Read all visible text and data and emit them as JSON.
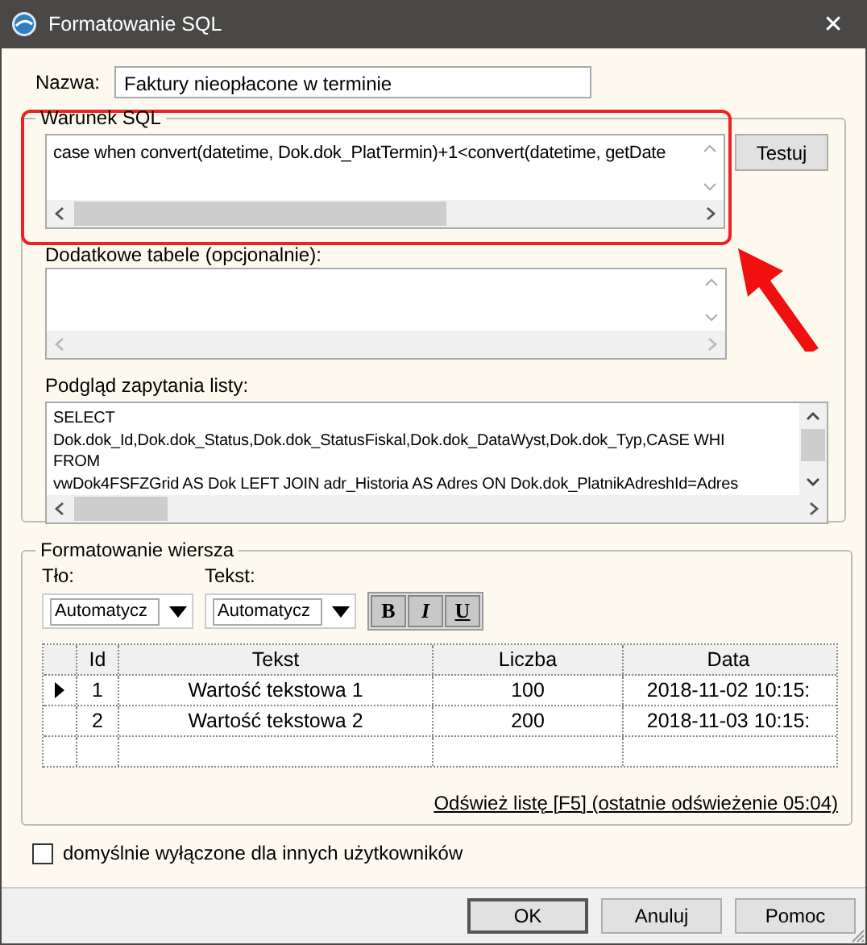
{
  "window": {
    "title": "Formatowanie SQL",
    "close": "✕"
  },
  "name": {
    "label": "Nazwa:",
    "value": "Faktury nieopłacone w terminie"
  },
  "sql_group": {
    "title": "Warunek SQL",
    "condition": "case when convert(datetime, Dok.dok_PlatTermin)+1<convert(datetime, getDate",
    "test_button": "Testuj",
    "extra_label": "Dodatkowe tabele (opcjonalnie):",
    "preview_label": "Podgląd zapytania listy:",
    "preview_lines": [
      "SELECT",
      "Dok.dok_Id,Dok.dok_Status,Dok.dok_StatusFiskal,Dok.dok_DataWyst,Dok.dok_Typ,CASE WHI",
      "FROM",
      "vwDok4FSFZGrid AS Dok LEFT JOIN adr_Historia AS Adres ON Dok.dok_PlatnikAdreshId=Adres"
    ]
  },
  "row_format": {
    "title": "Formatowanie wiersza",
    "background_label": "Tło:",
    "background_value": "Automatycz",
    "text_label": "Tekst:",
    "text_value": "Automatycz",
    "style_buttons": [
      {
        "label": "B",
        "kind": "bold"
      },
      {
        "label": "I",
        "kind": "italic"
      },
      {
        "label": "U",
        "kind": "underline"
      }
    ],
    "table": {
      "columns": [
        "Id",
        "Tekst",
        "Liczba",
        "Data"
      ],
      "rows": [
        {
          "selected": true,
          "cells": [
            "1",
            "Wartość tekstowa 1",
            "100",
            "2018-11-02 10:15:"
          ]
        },
        {
          "selected": false,
          "cells": [
            "2",
            "Wartość tekstowa 2",
            "200",
            "2018-11-03 10:15:"
          ]
        }
      ]
    },
    "refresh_link": "Odśwież listę [F5] (ostatnie odświeżenie 05:04)"
  },
  "default_off": {
    "label": "domyślnie wyłączone dla innych użytkowników",
    "checked": false
  },
  "buttons": [
    "OK",
    "Anuluj",
    "Pomoc"
  ]
}
